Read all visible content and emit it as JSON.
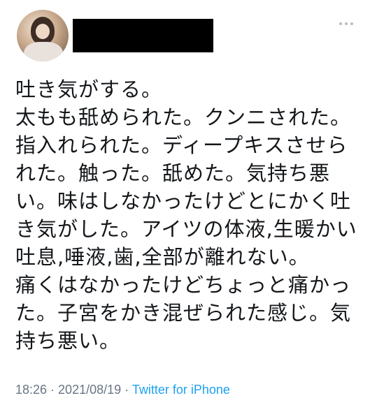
{
  "tweet": {
    "body_lines": [
      "吐き気がする。",
      "太もも舐められた。クンニされた。",
      "指入れられた。ディープキスさせら",
      "れた。触った。舐めた。気持ち悪",
      "い。味はしなかったけどとにかく吐",
      "き気がした。アイツの体液,生暖かい",
      "吐息,唾液,歯,全部が離れない。",
      "痛くはなかったけどちょっと痛かっ",
      "た。子宮をかき混ぜられた感じ。気",
      "持ち悪い。"
    ],
    "time": "18:26",
    "separator_1": " · ",
    "date": "2021/08/19",
    "separator_2": " · ",
    "source": "Twitter for iPhone"
  },
  "icons": {
    "more": "more-horizontal-icon"
  },
  "colors": {
    "text": "#14171a",
    "meta": "#687684",
    "link": "#1da1f2"
  }
}
